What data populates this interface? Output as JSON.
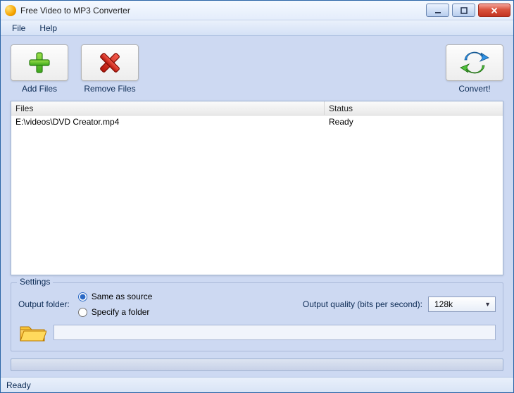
{
  "window": {
    "title": "Free Video to MP3 Converter"
  },
  "menu": {
    "file": "File",
    "help": "Help"
  },
  "toolbar": {
    "add_files": "Add Files",
    "remove_files": "Remove Files",
    "convert": "Convert!"
  },
  "table": {
    "headers": {
      "files": "Files",
      "status": "Status"
    },
    "rows": [
      {
        "file": "E:\\videos\\DVD Creator.mp4",
        "status": "Ready"
      }
    ]
  },
  "settings": {
    "legend": "Settings",
    "output_folder_label": "Output folder:",
    "same_as_source": "Same as source",
    "specify_folder": "Specify a folder",
    "folder_path": "",
    "quality_label": "Output quality (bits per second):",
    "quality_value": "128k"
  },
  "status": {
    "text": "Ready"
  }
}
